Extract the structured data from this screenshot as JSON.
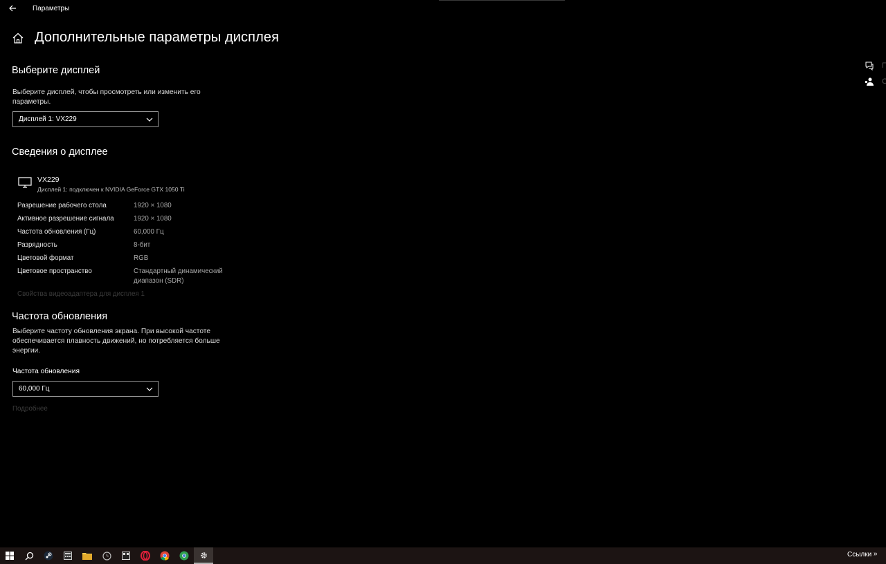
{
  "window": {
    "app_title": "Параметры"
  },
  "page": {
    "title": "Дополнительные параметры дисплея"
  },
  "select_display": {
    "heading": "Выберите дисплей",
    "description": "Выберите дисплей, чтобы просмотреть или изменить его параметры.",
    "dropdown_value": "Дисплей 1: VX229"
  },
  "display_info": {
    "heading": "Сведения о дисплее",
    "monitor_name": "VX229",
    "connection": "Дисплей 1: подключен к NVIDIA GeForce GTX 1050 Ti",
    "rows": [
      {
        "label": "Разрешение рабочего стола",
        "value": "1920 × 1080"
      },
      {
        "label": "Активное разрешение сигнала",
        "value": "1920 × 1080"
      },
      {
        "label": "Частота обновления (Гц)",
        "value": "60,000 Гц"
      },
      {
        "label": "Разрядность",
        "value": "8-бит"
      },
      {
        "label": "Цветовой формат",
        "value": "RGB"
      },
      {
        "label": "Цветовое пространство",
        "value": "Стандартный динамический диапазон (SDR)"
      }
    ],
    "adapter_link": "Свойства видеоадаптера для дисплея 1"
  },
  "refresh_rate": {
    "heading": "Частота обновления",
    "description": "Выберите частоту обновления экрана. При высокой частоте обеспечивается плавность движений, но потребляется больше энергии.",
    "field_label": "Частота обновления",
    "dropdown_value": "60,000 Гц",
    "more_link": "Подробнее"
  },
  "side_panel": {
    "items": [
      {
        "icon": "help-chat-icon",
        "label_cut": "П"
      },
      {
        "icon": "feedback-icon",
        "label_cut": "О"
      }
    ]
  },
  "taskbar": {
    "icons": [
      "windows-start-icon",
      "search-icon",
      "steam-icon",
      "calculator-icon",
      "file-explorer-icon",
      "clock-app-icon",
      "media-app-icon",
      "opera-icon",
      "chrome-icon",
      "chrome-green-icon",
      "settings-icon"
    ],
    "tray_text": "Ссылки",
    "tray_chevron": "»"
  }
}
